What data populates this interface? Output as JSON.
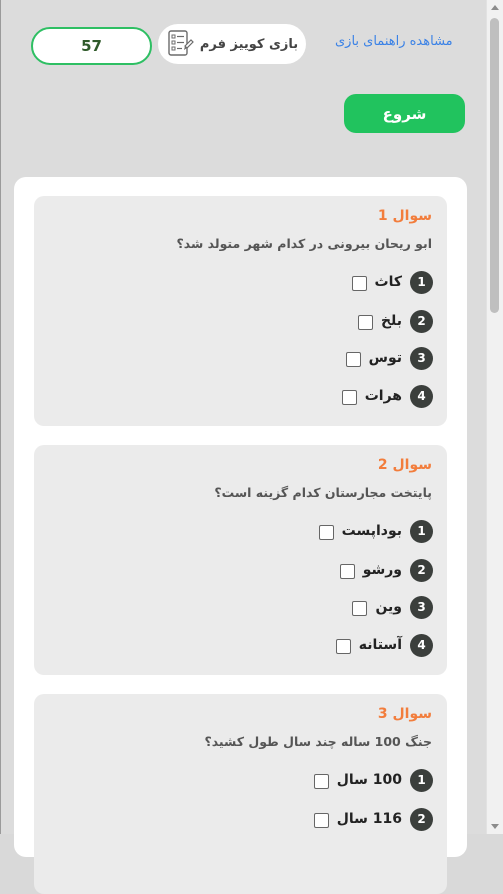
{
  "header": {
    "guide_link": "مشاهده راهنمای بازی",
    "quiz_label": "بازی کوییز فرم",
    "quiz_icon": "checklist-form-icon",
    "score": "57",
    "start_label": "شروع"
  },
  "colors": {
    "accent_green": "#21c35e",
    "question_orange": "#f27d3c",
    "link_blue": "#3b82e6"
  },
  "questions": [
    {
      "title": "سوال 1",
      "text": "ابو ریحان بیرونی در کدام شهر متولد شد؟",
      "options": [
        {
          "num": "1",
          "label": "کاث"
        },
        {
          "num": "2",
          "label": "بلخ"
        },
        {
          "num": "3",
          "label": "توس"
        },
        {
          "num": "4",
          "label": "هرات"
        }
      ]
    },
    {
      "title": "سوال 2",
      "text": "پایتخت مجارستان کدام گزینه است؟",
      "options": [
        {
          "num": "1",
          "label": "بوداپست"
        },
        {
          "num": "2",
          "label": "ورشو"
        },
        {
          "num": "3",
          "label": "وین"
        },
        {
          "num": "4",
          "label": "آستانه"
        }
      ]
    },
    {
      "title": "سوال 3",
      "text": "جنگ 100 ساله چند سال طول کشید؟",
      "options": [
        {
          "num": "1",
          "label": "100 سال"
        },
        {
          "num": "2",
          "label": "116 سال"
        }
      ]
    }
  ]
}
